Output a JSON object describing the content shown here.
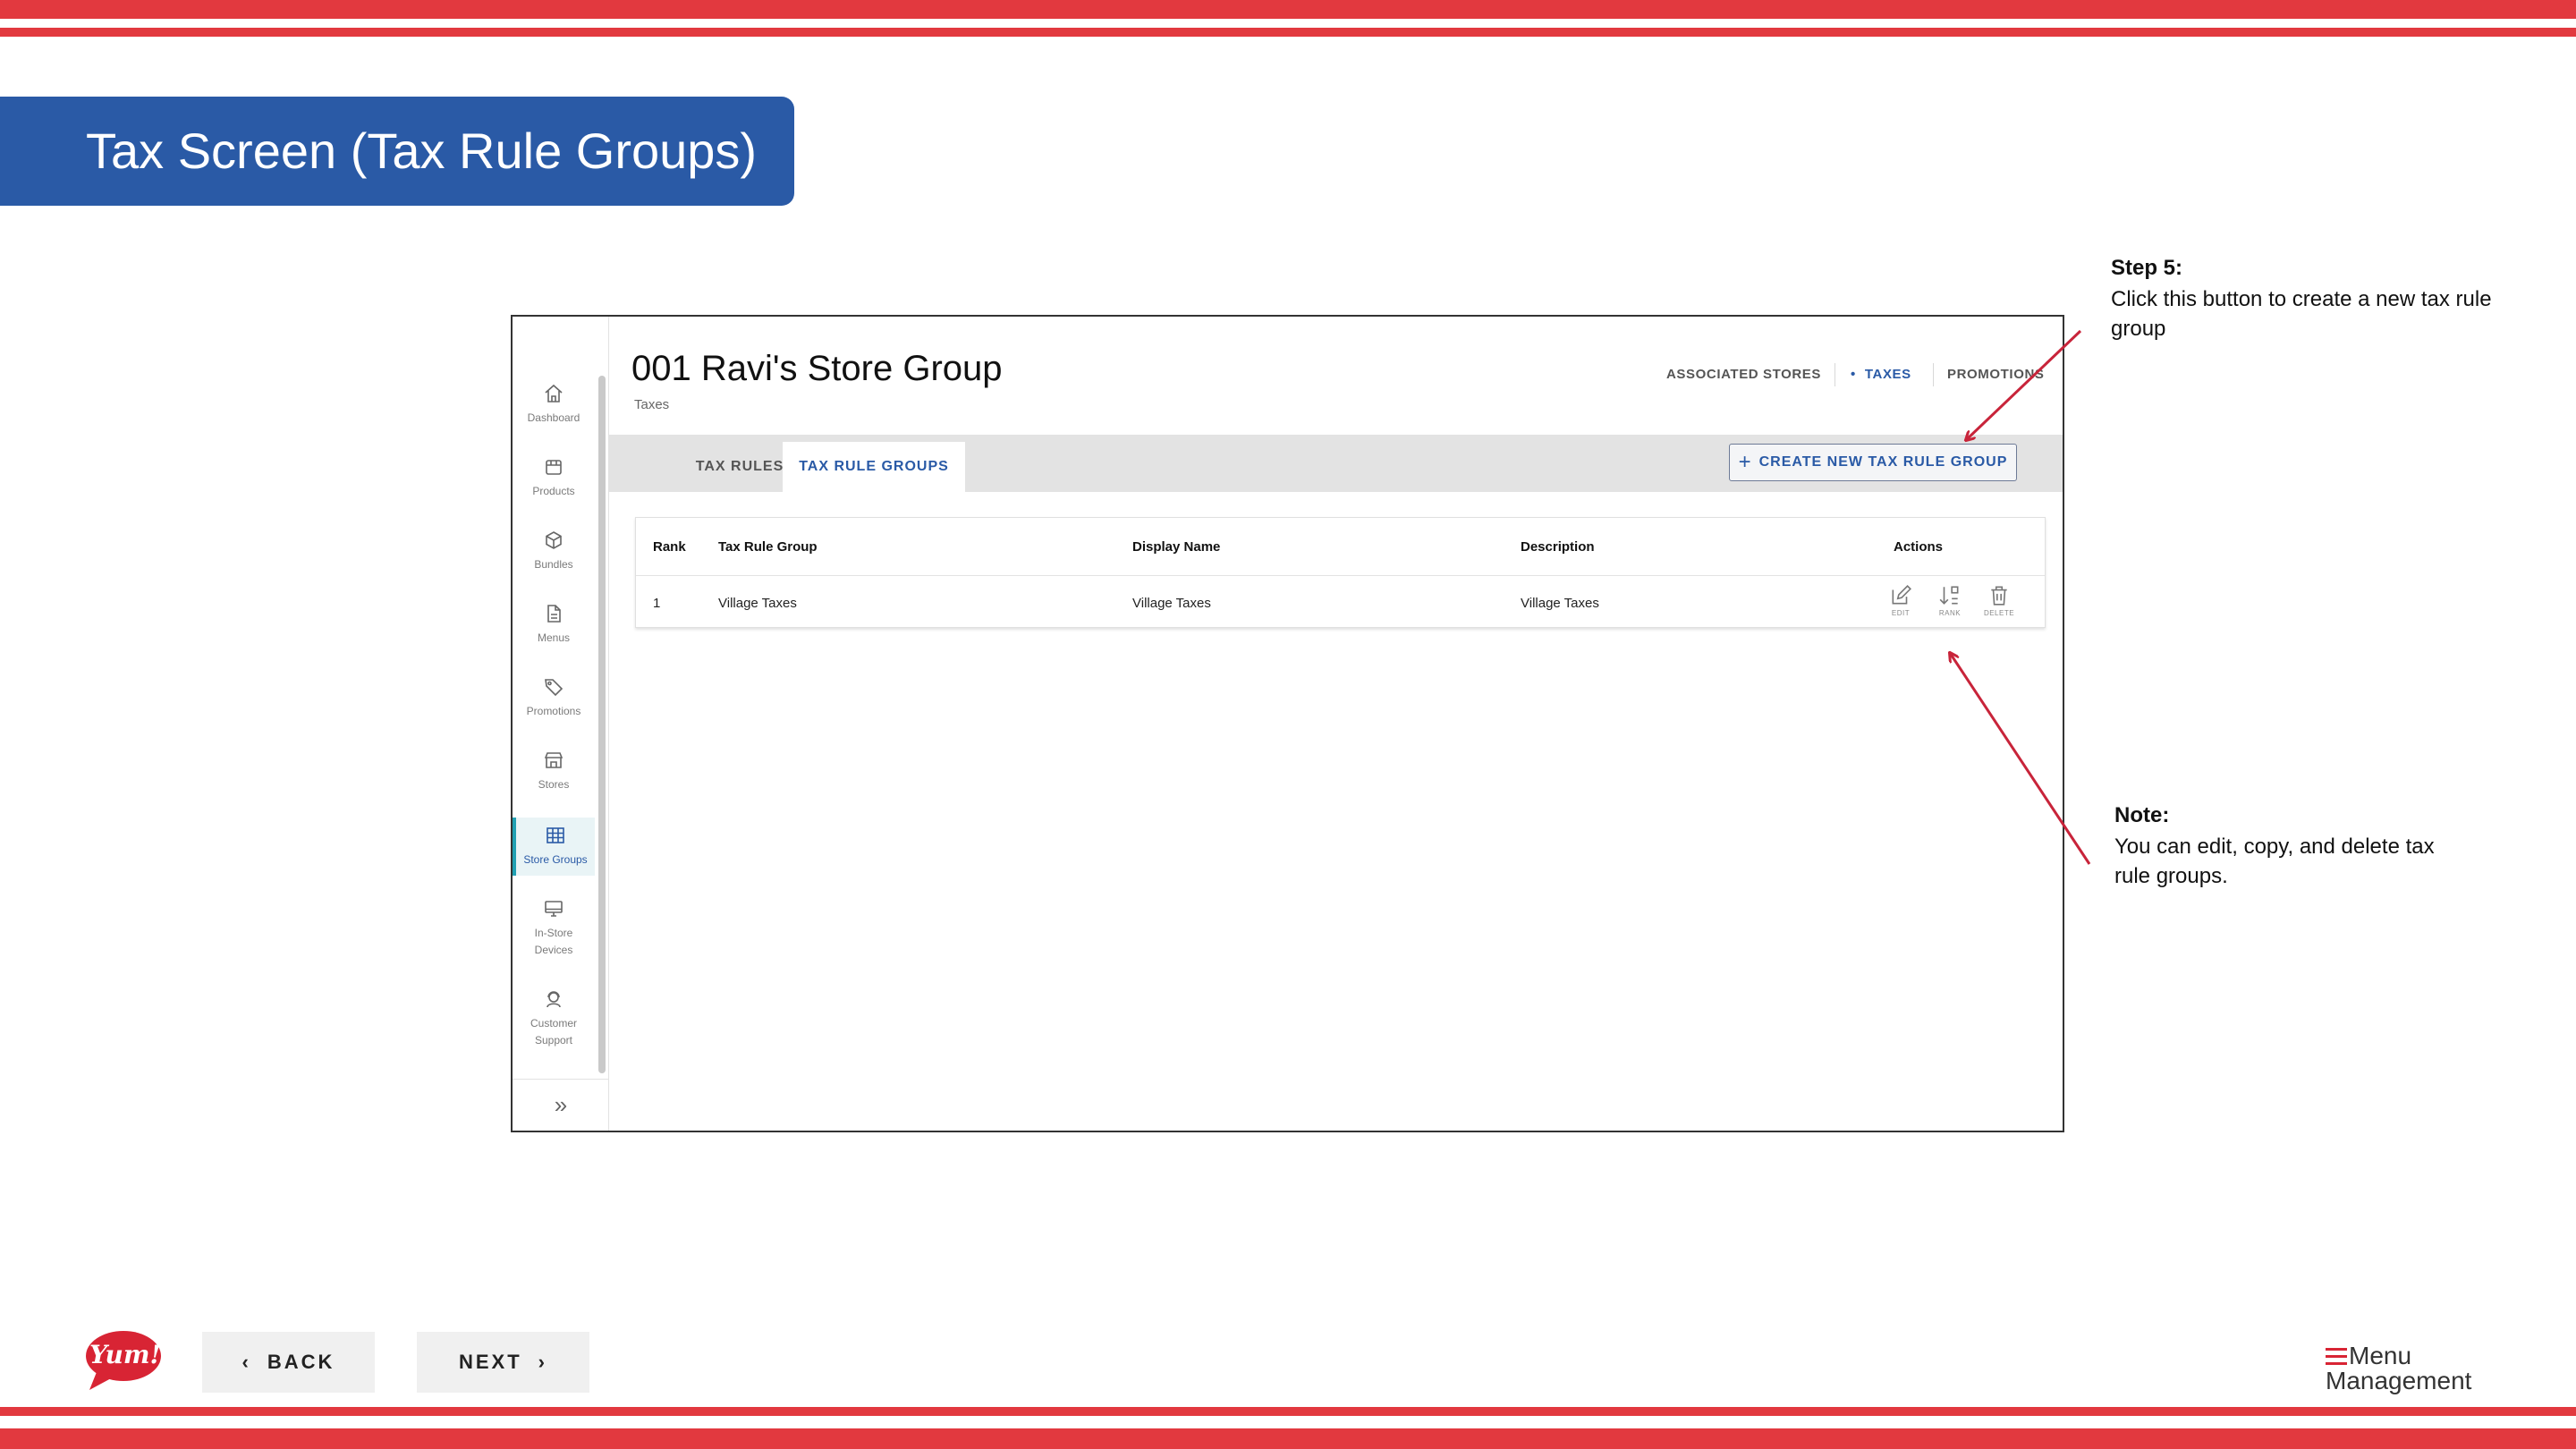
{
  "colors": {
    "accent_red": "#e2393f",
    "banner_blue": "#2a5aa6",
    "active_teal": "#21a1b3"
  },
  "slide_title": "Tax Screen (Tax Rule Groups)",
  "app": {
    "sidebar": {
      "items": [
        {
          "label": "Dashboard",
          "icon": "home-icon"
        },
        {
          "label": "Products",
          "icon": "box-icon"
        },
        {
          "label": "Bundles",
          "icon": "cube-icon"
        },
        {
          "label": "Menus",
          "icon": "document-icon"
        },
        {
          "label": "Promotions",
          "icon": "tag-icon"
        },
        {
          "label": "Stores",
          "icon": "storefront-icon"
        },
        {
          "label": "Store Groups",
          "icon": "grid-icon",
          "active": true
        },
        {
          "label_line1": "In-Store",
          "label_line2": "Devices",
          "icon": "monitor-icon"
        },
        {
          "label_line1": "Customer",
          "label_line2": "Support",
          "icon": "headset-icon"
        }
      ],
      "expand_icon": "double-chevron-right-icon"
    },
    "header": {
      "title": "001 Ravi's Store Group",
      "subtitle": "Taxes",
      "nav": [
        {
          "label": "ASSOCIATED STORES"
        },
        {
          "label": "TAXES",
          "active": true
        },
        {
          "label": "PROMOTIONS"
        }
      ]
    },
    "tabs": [
      {
        "label": "TAX RULES"
      },
      {
        "label": "TAX RULE GROUPS",
        "active": true
      }
    ],
    "create_button": "CREATE NEW TAX RULE GROUP",
    "table": {
      "columns": [
        "Rank",
        "Tax Rule Group",
        "Display Name",
        "Description",
        "Actions"
      ],
      "rows": [
        {
          "rank": "1",
          "tax_rule_group": "Village Taxes",
          "display_name": "Village Taxes",
          "description": "Village Taxes"
        }
      ],
      "actions": [
        {
          "label": "EDIT",
          "icon": "edit-icon"
        },
        {
          "label": "RANK",
          "icon": "sort-icon"
        },
        {
          "label": "DELETE",
          "icon": "trash-icon"
        }
      ]
    }
  },
  "annotations": {
    "step": {
      "heading": "Step 5:",
      "line1": "Click this button to create a new tax rule",
      "line2": "group"
    },
    "note": {
      "heading": "Note:",
      "line1": "You can edit, copy, and delete tax",
      "line2": "rule groups."
    }
  },
  "footer": {
    "back_label": "BACK",
    "next_label": "NEXT",
    "brand_logo_text": "Yum!",
    "product_logo_line1": "Menu",
    "product_logo_line2": "Management"
  }
}
